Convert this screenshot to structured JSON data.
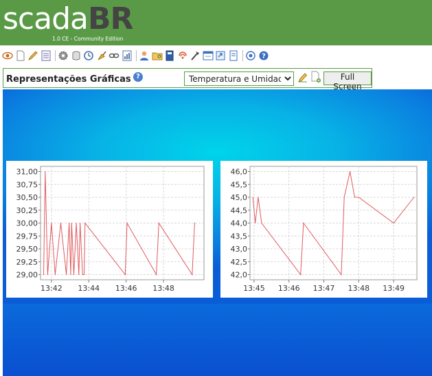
{
  "header": {
    "logo_text": "scada",
    "logo_text_bold": "BR",
    "edition": "1.0 CE - Community Edition",
    "bg_color": "#5a9a46"
  },
  "toolbar": {
    "icons": [
      "eye-icon",
      "new-document-icon",
      "edit-icon",
      "list-icon",
      "gear-icon",
      "database-icon",
      "clock-icon",
      "broom-icon",
      "link-icon",
      "report-icon",
      "user-icon",
      "folder-key-icon",
      "book-icon",
      "signal-icon",
      "tools-icon",
      "window-icon",
      "export-icon",
      "page-icon",
      "record-icon",
      "help-icon"
    ]
  },
  "view": {
    "title": "Representações Gráficas",
    "selected_view": "Temperatura e Umidade",
    "full_screen_label": "Full Screen"
  },
  "chart_data": [
    {
      "type": "line",
      "title": "",
      "xlabel": "",
      "ylabel": "",
      "ylim": [
        28.9,
        31.1
      ],
      "xlim": [
        "13:41:25",
        "13:50:10"
      ],
      "y_ticks": [
        "31,00",
        "30,75",
        "30,50",
        "30,25",
        "30,00",
        "29,75",
        "29,50",
        "29,25",
        "29,00"
      ],
      "x_ticks": [
        "13:42",
        "13:44",
        "13:46",
        "13:48"
      ],
      "grid": true,
      "line_color": "#e0595e",
      "x": [
        "13:41:35",
        "13:41:40",
        "13:41:48",
        "13:42:00",
        "13:42:12",
        "13:42:30",
        "13:42:48",
        "13:42:57",
        "13:43:02",
        "13:43:05",
        "13:43:12",
        "13:43:20",
        "13:43:28",
        "13:43:32",
        "13:43:40",
        "13:43:45",
        "13:43:48",
        "13:45:57",
        "13:46:03",
        "13:47:37",
        "13:47:45",
        "13:49:32",
        "13:49:40"
      ],
      "y": [
        29.0,
        31.0,
        29.0,
        30.0,
        29.0,
        30.0,
        29.0,
        30.0,
        29.0,
        30.0,
        29.0,
        30.0,
        29.0,
        30.0,
        29.0,
        29.0,
        30.0,
        29.0,
        30.0,
        29.0,
        30.0,
        29.0,
        30.0
      ]
    },
    {
      "type": "line",
      "title": "",
      "xlabel": "",
      "ylabel": "",
      "ylim": [
        41.8,
        46.2
      ],
      "xlim": [
        "13:44:53",
        "13:49:40"
      ],
      "y_ticks": [
        "46,0",
        "45,5",
        "45,0",
        "44,5",
        "44,0",
        "43,5",
        "43,0",
        "42,5",
        "42,0"
      ],
      "x_ticks": [
        "13:45",
        "13:46",
        "13:47",
        "13:48",
        "13:49"
      ],
      "grid": true,
      "line_color": "#e0595e",
      "x": [
        "13:44:58",
        "13:45:02",
        "13:45:07",
        "13:45:13",
        "13:46:20",
        "13:46:25",
        "13:47:30",
        "13:47:35",
        "13:47:45",
        "13:47:53",
        "13:48:00",
        "13:49:00",
        "13:49:35"
      ],
      "y": [
        45.0,
        44.0,
        45.0,
        44.0,
        42.0,
        44.0,
        42.0,
        45.0,
        46.0,
        45.0,
        45.0,
        44.0,
        45.0
      ]
    }
  ]
}
